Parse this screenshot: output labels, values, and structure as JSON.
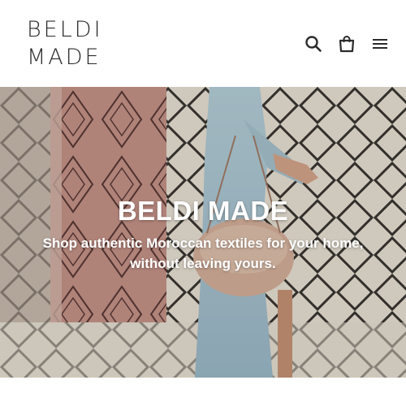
{
  "header": {
    "logo_line1": "BELDI",
    "logo_line2": "MADE",
    "icons": [
      "search-icon",
      "cart-icon",
      "menu-icon"
    ]
  },
  "hero": {
    "title": "BELDI MADE",
    "subtitle": "Shop authentic Moroccan textiles for your home, without leaving yours."
  },
  "colors": {
    "text": "#2b2b2b",
    "hero_text": "#ffffff",
    "background": "#ffffff"
  }
}
